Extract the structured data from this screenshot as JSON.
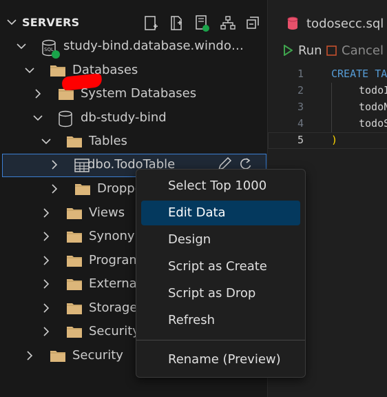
{
  "explorer": {
    "section_title": "SERVERS",
    "header_icons": [
      "new-query-icon",
      "new-notebook-icon",
      "server-connected-icon",
      "group-icon",
      "collapse-all-icon"
    ],
    "tree": [
      {
        "id": "server",
        "label": "study-bind.database.windo…",
        "icon": "sql-server-icon"
      },
      {
        "id": "databases",
        "label": "Databases",
        "icon": "folder-icon"
      },
      {
        "id": "system-databases",
        "label": "System Databases",
        "icon": "folder-icon"
      },
      {
        "id": "db-study-bind",
        "label": "db-study-bind",
        "icon": "database-icon"
      },
      {
        "id": "tables",
        "label": "Tables",
        "icon": "folder-icon"
      },
      {
        "id": "dbo-todotable",
        "label": "dbo.TodoTable",
        "icon": "table-icon"
      },
      {
        "id": "dropped",
        "label": "Droppe",
        "icon": "folder-icon"
      },
      {
        "id": "views",
        "label": "Views",
        "icon": "folder-icon"
      },
      {
        "id": "synonyms",
        "label": "Synonym",
        "icon": "folder-icon"
      },
      {
        "id": "programmability",
        "label": "Program",
        "icon": "folder-icon"
      },
      {
        "id": "external",
        "label": "External",
        "icon": "folder-icon"
      },
      {
        "id": "storage",
        "label": "Storage",
        "icon": "folder-icon"
      },
      {
        "id": "db-security",
        "label": "Security",
        "icon": "folder-icon"
      },
      {
        "id": "server-security",
        "label": "Security",
        "icon": "folder-icon"
      }
    ]
  },
  "editor": {
    "tab_label": "todosecc.sql",
    "run_label": "Run",
    "cancel_label": "Cancel",
    "line_numbers": [
      "1",
      "2",
      "3",
      "4",
      "5"
    ],
    "code": {
      "keyword_1": "CREATE",
      "keyword_2": "TA",
      "line_2": "todoI",
      "line_3": "todoN",
      "line_4": "todoS",
      "line_5": ")"
    }
  },
  "context_menu": {
    "items": [
      {
        "label": "Select Top 1000"
      },
      {
        "label": "Edit Data"
      },
      {
        "label": "Design"
      },
      {
        "label": "Script as Create"
      },
      {
        "label": "Script as Drop"
      },
      {
        "label": "Refresh"
      },
      {
        "label": "Rename (Preview)"
      }
    ],
    "highlighted": "Edit Data"
  },
  "colors": {
    "accent": "#04395e",
    "selection_border": "#3c7fd4",
    "folder": "#dcb67a",
    "connected": "#1aa34a",
    "run": "#3fa34d",
    "cancel": "#c5502e",
    "sql_file": "#e8516b"
  }
}
